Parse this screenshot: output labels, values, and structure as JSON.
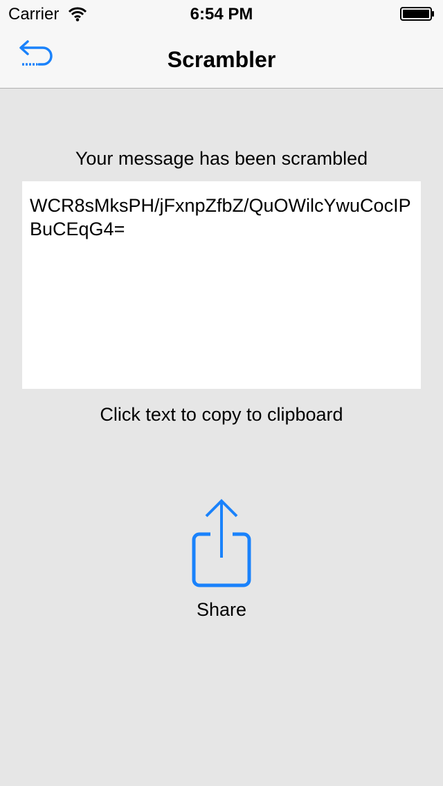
{
  "status_bar": {
    "carrier": "Carrier",
    "time": "6:54 PM",
    "wifi_icon": "wifi-icon",
    "battery_icon": "battery-icon"
  },
  "nav_bar": {
    "title": "Scrambler",
    "back_icon": "undo-arrow-icon"
  },
  "content": {
    "message_label": "Your message has been scrambled",
    "scrambled_text": "WCR8sMksPH/jFxnpZfbZ/QuOWilcYwuCocIPBuCEqG4=",
    "copy_hint": "Click text to copy to clipboard",
    "share_label": "Share",
    "share_icon": "share-icon"
  },
  "colors": {
    "accent": "#1a82fb",
    "background": "#e6e6e6",
    "bar_background": "#f7f7f7",
    "text_area": "#ffffff"
  }
}
